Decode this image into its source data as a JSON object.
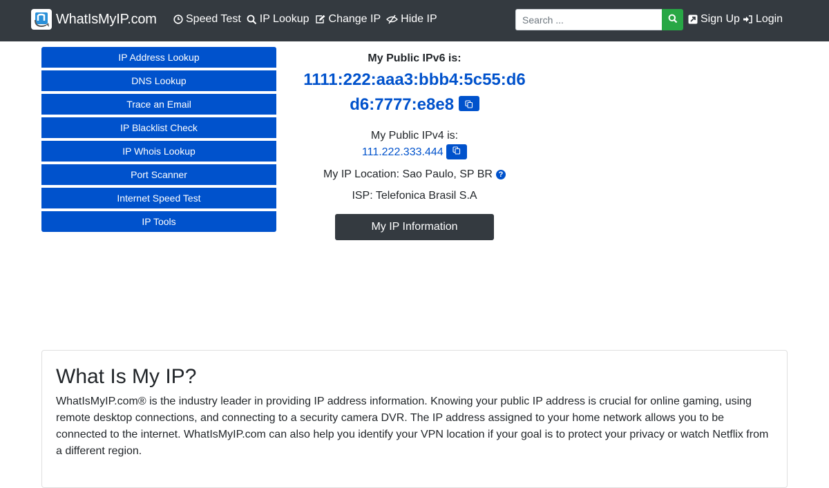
{
  "navbar": {
    "brand": "WhatIsMyIP.com",
    "links": [
      {
        "label": "Speed Test",
        "icon": "clock-icon"
      },
      {
        "label": "IP Lookup",
        "icon": "search-icon"
      },
      {
        "label": "Change IP",
        "icon": "edit-icon"
      },
      {
        "label": "Hide IP",
        "icon": "eye-slash-icon"
      }
    ],
    "search_placeholder": "Search ...",
    "signup": "Sign Up",
    "login": "Login"
  },
  "sidebar": {
    "items": [
      {
        "label": "IP Address Lookup"
      },
      {
        "label": "DNS Lookup"
      },
      {
        "label": "Trace an Email"
      },
      {
        "label": "IP Blacklist Check"
      },
      {
        "label": "IP Whois Lookup"
      },
      {
        "label": "Port Scanner"
      },
      {
        "label": "Internet Speed Test"
      },
      {
        "label": "IP Tools"
      }
    ]
  },
  "ip": {
    "ipv6_label": "My Public IPv6 is:",
    "ipv6": "1111:222:aaa3:bbb4:5c55:d6d6:7777:e8e8",
    "ipv4_label": "My Public IPv4 is:",
    "ipv4": "111.222.333.444",
    "location": "My IP Location: Sao Paulo, SP BR",
    "isp": "ISP: Telefonica Brasil S.A",
    "info_button": "My IP Information"
  },
  "about": {
    "title": "What Is My IP?",
    "body": "WhatIsMyIP.com® is the industry leader in providing IP address information. Knowing your public IP address is crucial for online gaming, using remote desktop connections, and connecting to a security camera DVR. The IP address assigned to your home network allows you to be connected to the internet. WhatIsMyIP.com can also help you identify your VPN location if your goal is to protect your privacy or watch Netflix from a different region."
  },
  "colors": {
    "navbar": "#343a40",
    "primary": "#0052cc",
    "search_button": "#28a745"
  }
}
